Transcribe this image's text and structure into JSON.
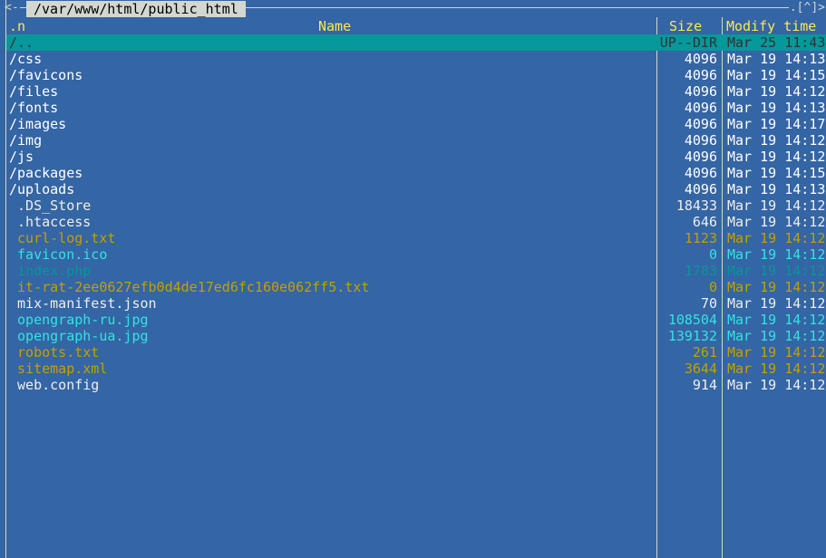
{
  "panel": {
    "path": "/var/www/html/public_html",
    "left_corner": "<-",
    "right_corner": ".[^]>"
  },
  "header": {
    "sort": ".n",
    "name": "Name",
    "size": "Size",
    "time": "Modify time"
  },
  "files": [
    {
      "name": "/..",
      "size": "UP--DIR",
      "time": "Mar 25 11:43",
      "color": "selected"
    },
    {
      "name": "/css",
      "size": "4096",
      "time": "Mar 19 14:13",
      "color": "white"
    },
    {
      "name": "/favicons",
      "size": "4096",
      "time": "Mar 19 14:15",
      "color": "white"
    },
    {
      "name": "/files",
      "size": "4096",
      "time": "Mar 19 14:12",
      "color": "white"
    },
    {
      "name": "/fonts",
      "size": "4096",
      "time": "Mar 19 14:13",
      "color": "white"
    },
    {
      "name": "/images",
      "size": "4096",
      "time": "Mar 19 14:17",
      "color": "white"
    },
    {
      "name": "/img",
      "size": "4096",
      "time": "Mar 19 14:12",
      "color": "white"
    },
    {
      "name": "/js",
      "size": "4096",
      "time": "Mar 19 14:12",
      "color": "white"
    },
    {
      "name": "/packages",
      "size": "4096",
      "time": "Mar 19 14:15",
      "color": "white"
    },
    {
      "name": "/uploads",
      "size": "4096",
      "time": "Mar 19 14:13",
      "color": "white"
    },
    {
      "name": " .DS_Store",
      "size": "18433",
      "time": "Mar 19 14:12",
      "color": "dim"
    },
    {
      "name": " .htaccess",
      "size": "646",
      "time": "Mar 19 14:12",
      "color": "dim"
    },
    {
      "name": " curl-log.txt",
      "size": "1123",
      "time": "Mar 19 14:12",
      "color": "yellow"
    },
    {
      "name": " favicon.ico",
      "size": "0",
      "time": "Mar 19 14:12",
      "color": "cyan"
    },
    {
      "name": " index.php",
      "size": "1783",
      "time": "Mar 19 14:12",
      "color": "teal"
    },
    {
      "name": " it-rat-2ee0627efb0d4de17ed6fc160e062ff5.txt",
      "size": "0",
      "time": "Mar 19 14:12",
      "color": "yellow"
    },
    {
      "name": " mix-manifest.json",
      "size": "70",
      "time": "Mar 19 14:12",
      "color": "dim"
    },
    {
      "name": " opengraph-ru.jpg",
      "size": "108504",
      "time": "Mar 19 14:12",
      "color": "cyan"
    },
    {
      "name": " opengraph-ua.jpg",
      "size": "139132",
      "time": "Mar 19 14:12",
      "color": "cyan"
    },
    {
      "name": " robots.txt",
      "size": "261",
      "time": "Mar 19 14:12",
      "color": "yellow"
    },
    {
      "name": " sitemap.xml",
      "size": "3644",
      "time": "Mar 19 14:12",
      "color": "yellow"
    },
    {
      "name": " web.config",
      "size": "914",
      "time": "Mar 19 14:12",
      "color": "dim"
    }
  ],
  "colors": {
    "panel_bg": "#3465a4",
    "selected_bg": "#06989a",
    "header": "#fce94f",
    "yellow": "#c4a000",
    "cyan": "#34e2e2",
    "teal": "#06989a"
  }
}
